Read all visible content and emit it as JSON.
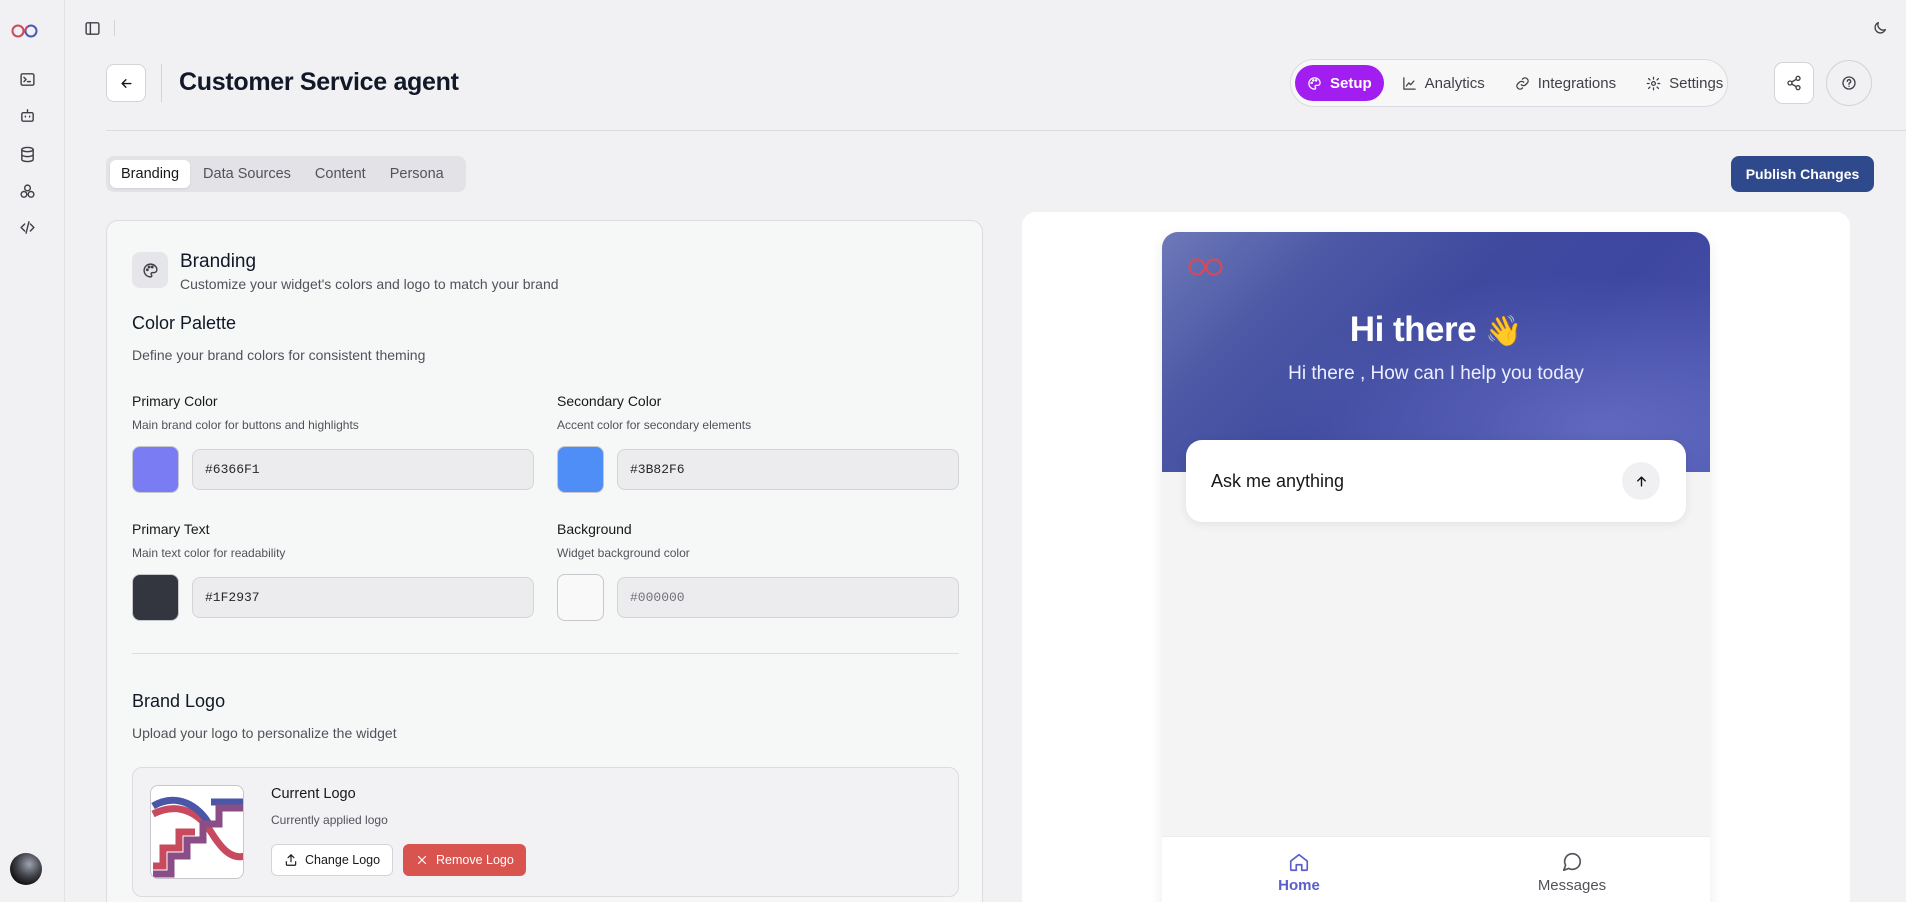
{
  "app": {
    "title": "Customer Service agent"
  },
  "topnav": {
    "setup": "Setup",
    "analytics": "Analytics",
    "integrations": "Integrations",
    "settings": "Settings"
  },
  "tabs": [
    "Branding",
    "Data Sources",
    "Content",
    "Persona"
  ],
  "publish_label": "Publish Changes",
  "branding": {
    "title": "Branding",
    "subtitle": "Customize your widget's colors and logo to match your brand",
    "palette": {
      "title": "Color Palette",
      "subtitle": "Define your brand colors for consistent theming",
      "fields": [
        {
          "label": "Primary Color",
          "hint": "Main brand color for buttons and highlights",
          "value": "#6366F1",
          "placeholder": "",
          "swatch": "#7a7cf4"
        },
        {
          "label": "Secondary Color",
          "hint": "Accent color for secondary elements",
          "value": "#3B82F6",
          "placeholder": "",
          "swatch": "#4f8ef7"
        },
        {
          "label": "Primary Text",
          "hint": "Main text color for readability",
          "value": "#1F2937",
          "placeholder": "",
          "swatch": "#33363f"
        },
        {
          "label": "Background",
          "hint": "Widget background color",
          "value": "",
          "placeholder": "#000000",
          "swatch": "#f9f9fa"
        }
      ]
    },
    "logo": {
      "title": "Brand Logo",
      "subtitle": "Upload your logo to personalize the widget",
      "current_title": "Current Logo",
      "current_sub": "Currently applied logo",
      "change_label": "Change Logo",
      "remove_label": "Remove Logo"
    }
  },
  "preview": {
    "greeting": "Hi there",
    "wave": "👋",
    "subtitle": "Hi there , How can I help you today",
    "ask_placeholder": "Ask me anything",
    "nav": {
      "home": "Home",
      "messages": "Messages"
    }
  },
  "colors": {
    "accent": "#a21ef0",
    "publish": "#2f4a8c",
    "remove": "#d9534f",
    "nav_active": "#5b5fc7"
  }
}
